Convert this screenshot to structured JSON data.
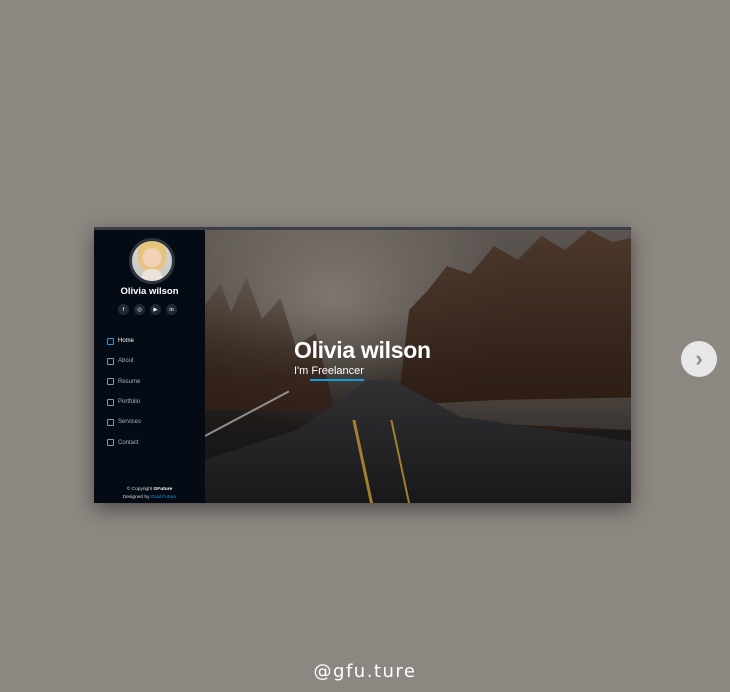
{
  "sidebar": {
    "profile_name": "Olivia wilson",
    "social": [
      {
        "icon": "facebook-icon",
        "glyph": "f"
      },
      {
        "icon": "instagram-icon",
        "glyph": "◎"
      },
      {
        "icon": "youtube-icon",
        "glyph": "▶"
      },
      {
        "icon": "linkedin-icon",
        "glyph": "in"
      }
    ],
    "nav": [
      {
        "label": "Home",
        "icon": "home-icon",
        "active": true
      },
      {
        "label": "About",
        "icon": "user-icon",
        "active": false
      },
      {
        "label": "Resume",
        "icon": "file-icon",
        "active": false
      },
      {
        "label": "Portfolio",
        "icon": "book-icon",
        "active": false
      },
      {
        "label": "Services",
        "icon": "server-icon",
        "active": false
      },
      {
        "label": "Contact",
        "icon": "envelope-icon",
        "active": false
      }
    ],
    "footer": {
      "copyright_prefix": "© Copyright",
      "brand": "GFuture",
      "designed_by_prefix": "Designed by",
      "designer": "Goal Future"
    }
  },
  "hero": {
    "name": "Olivia wilson",
    "subtitle": "I'm Freelancer"
  },
  "carousel": {
    "next_icon": "chevron-right-icon",
    "next_glyph": "›"
  },
  "handle": "@gfu.ture",
  "colors": {
    "background": "#8d8782",
    "sidebar": "#040b14",
    "accent": "#149ddd"
  }
}
